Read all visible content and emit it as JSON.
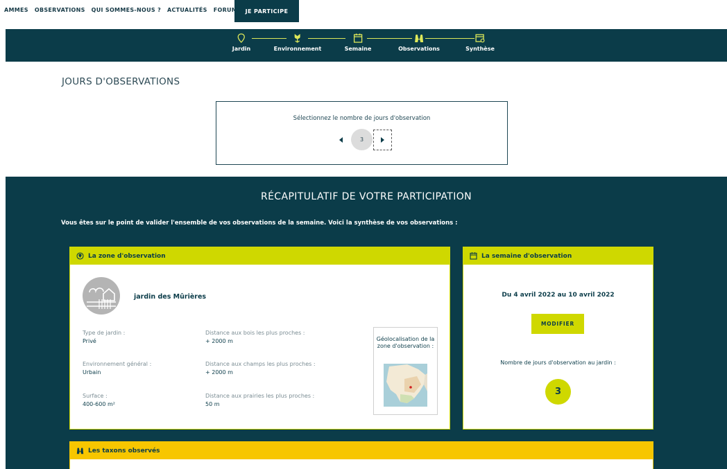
{
  "topnav": {
    "links": [
      "AMMES",
      "OBSERVATIONS",
      "QUI SOMMES-NOUS ?",
      "ACTUALITÉS",
      "FORUM"
    ],
    "cta_label": "JE PARTICIPE"
  },
  "stepper": {
    "steps": [
      {
        "label": "Jardin",
        "icon": "location-pin-icon"
      },
      {
        "label": "Environnement",
        "icon": "flower-icon"
      },
      {
        "label": "Semaine",
        "icon": "calendar-icon"
      },
      {
        "label": "Observations",
        "icon": "butterfly-icon"
      },
      {
        "label": "Synthèse",
        "icon": "summary-card-icon"
      }
    ],
    "accent": "#dde85a"
  },
  "jours": {
    "title": "JOURS D'OBSERVATIONS",
    "prompt": "Sélectionnez le nombre de jours d'observation",
    "count": "3"
  },
  "recap": {
    "title": "RÉCAPITULATIF DE VOTRE PARTICIPATION",
    "intro": "Vous êtes sur le point de valider l'ensemble de vos observations de la semaine. Voici la synthèse de vos observations :",
    "zone": {
      "header": "La zone d'observation",
      "garden_name": "jardin des Mûrières",
      "fields": [
        {
          "label": "Type de jardin :",
          "value": "Privé"
        },
        {
          "label": "Environnement général :",
          "value": "Urbain"
        },
        {
          "label": "Surface :",
          "value": "400-600 m²"
        },
        {
          "label": "Distance aux bois les plus proches :",
          "value": "+ 2000 m"
        },
        {
          "label": "Distance aux champs les plus proches :",
          "value": "+ 2000 m"
        },
        {
          "label": "Distance aux prairies les plus proches :",
          "value": "50 m"
        }
      ],
      "geo_label": "Géolocalisation de la zone d'observation :"
    },
    "week": {
      "header": "La semaine d'observation",
      "range": "Du 4 avril 2022 au 10 avril 2022",
      "modify_label": "MODIFIER",
      "days_label": "Nombre de jours d'observation au jardin :",
      "days_value": "3"
    },
    "taxa": {
      "header": "Les taxons observés"
    }
  },
  "colors": {
    "primary": "#0b3c49",
    "lime": "#cfd800",
    "yellow": "#f7c600"
  }
}
